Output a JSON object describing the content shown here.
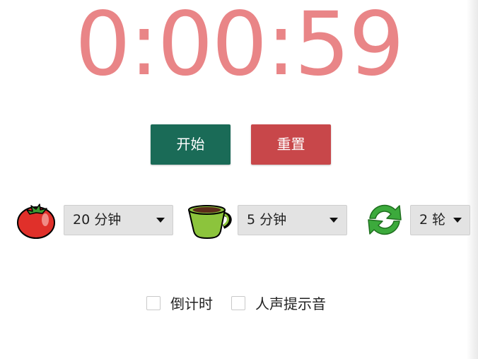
{
  "timer": {
    "display": "0:00:59",
    "color": "#e98587"
  },
  "buttons": {
    "start_label": "开始",
    "reset_label": "重置",
    "start_color": "#1a6b57",
    "reset_color": "#c8474a"
  },
  "settings": {
    "work": {
      "icon": "tomato-icon",
      "value": "20 分钟"
    },
    "break": {
      "icon": "coffee-cup-icon",
      "value": "5 分钟"
    },
    "rounds": {
      "icon": "refresh-icon",
      "value": "2 轮"
    }
  },
  "options": {
    "countdown_label": "倒计时",
    "countdown_checked": false,
    "voice_label": "人声提示音",
    "voice_checked": false
  }
}
